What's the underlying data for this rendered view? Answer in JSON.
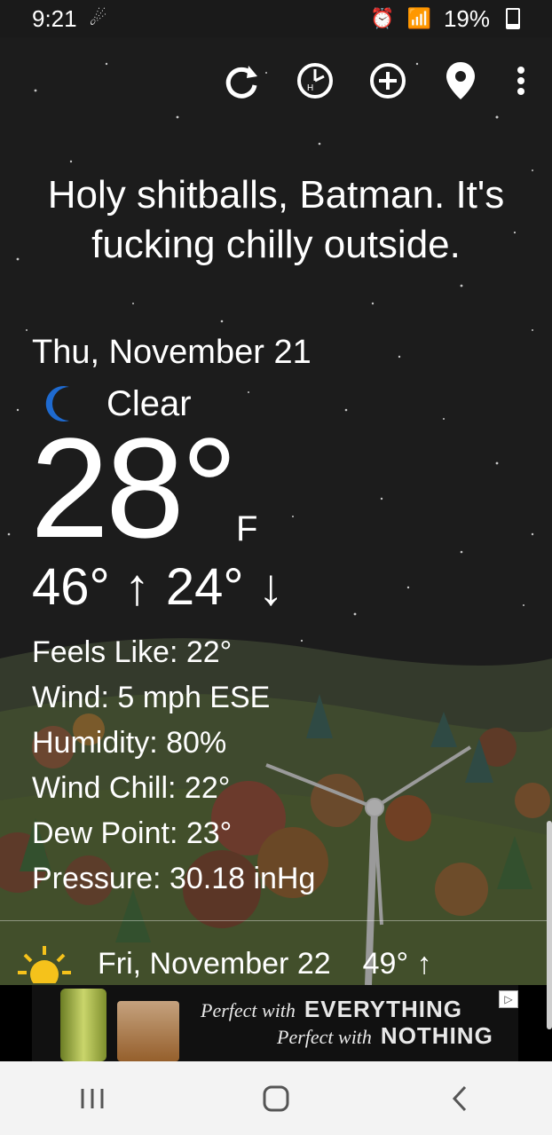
{
  "status_bar": {
    "time": "9:21",
    "battery": "19%"
  },
  "headline": "Holy shitballs, Batman. It's fucking chilly outside.",
  "today": {
    "date": "Thu, November 21",
    "condition": "Clear",
    "condition_icon": "moon-icon",
    "temperature": "28°",
    "unit": "F",
    "high": "46° ↑",
    "low": "24° ↓",
    "details": [
      "Feels Like: 22°",
      "Wind: 5 mph ESE",
      "Humidity: 80%",
      "Wind Chill: 22°",
      "Dew Point: 23°",
      "Pressure: 30.18 inHg"
    ]
  },
  "forecast": [
    {
      "date": "Fri, November 22",
      "high": "49° ↑",
      "icon": "sun-icon"
    }
  ],
  "ad": {
    "line1_lead": "Perfect with",
    "line1_big": "EVERYTHING",
    "line2_lead": "Perfect with",
    "line2_big": "NOTHING"
  },
  "toolbar_icons": [
    "refresh-icon",
    "history-icon",
    "add-location-icon",
    "location-pin-icon",
    "more-vert-icon"
  ],
  "colors": {
    "moon": "#1e6ad0",
    "sun": "#f5c21b",
    "hill": "#3c4430"
  }
}
